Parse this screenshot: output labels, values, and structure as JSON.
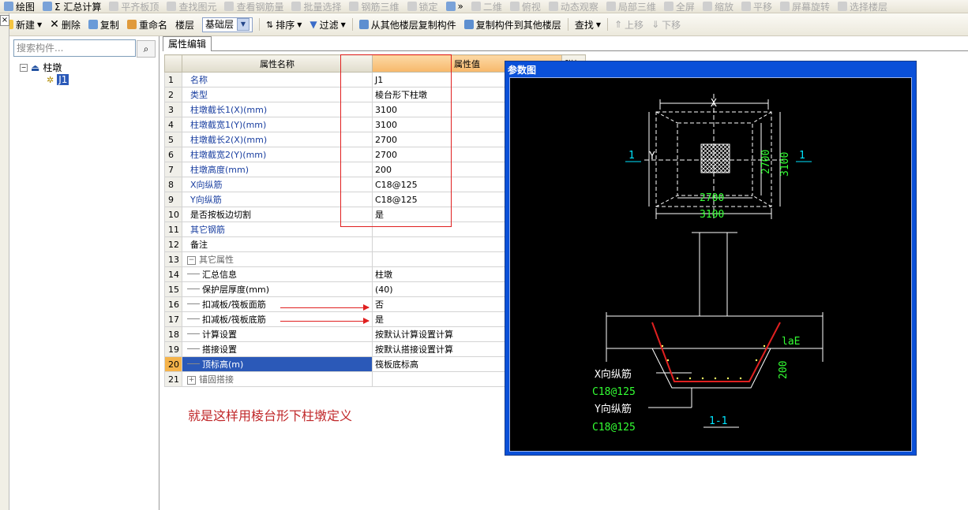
{
  "toolbar1": {
    "items": [
      {
        "label": "绘图",
        "disabled": false
      },
      {
        "label": "Σ 汇总计算",
        "disabled": false
      },
      {
        "label": "平齐板顶",
        "disabled": true
      },
      {
        "label": "查找图元",
        "disabled": true
      },
      {
        "label": "查看钢筋量",
        "disabled": true
      },
      {
        "label": "批量选择",
        "disabled": true
      },
      {
        "label": "钢筋三维",
        "disabled": true
      },
      {
        "label": "锁定",
        "disabled": true
      },
      {
        "label": "»",
        "disabled": false
      },
      {
        "label": "二维",
        "disabled": true
      },
      {
        "label": "俯视",
        "disabled": true
      },
      {
        "label": "动态观察",
        "disabled": true
      },
      {
        "label": "局部三维",
        "disabled": true
      },
      {
        "label": "全屏",
        "disabled": true
      },
      {
        "label": "缩放",
        "disabled": true
      },
      {
        "label": "平移",
        "disabled": true
      },
      {
        "label": "屏幕旋转",
        "disabled": true
      },
      {
        "label": "选择楼层",
        "disabled": true
      }
    ]
  },
  "toolbar2": {
    "new_label": "新建",
    "delete_label": "删除",
    "copy_label": "复制",
    "rename_label": "重命名",
    "floor_label": "楼层",
    "floor_value": "基础层",
    "sort_label": "排序",
    "filter_label": "过滤",
    "copy_from_label": "从其他楼层复制构件",
    "copy_to_label": "复制构件到其他楼层",
    "find_label": "查找",
    "up_label": "上移",
    "down_label": "下移"
  },
  "left_tab": {
    "close": "×"
  },
  "sidebar": {
    "search_placeholder": "搜索构件...",
    "root_label": "柱墩",
    "child_label": "J1"
  },
  "tab": {
    "label": "属性编辑"
  },
  "table": {
    "col_name": "属性名称",
    "col_value": "属性值",
    "col_extra": "附加",
    "rows": [
      {
        "n": "1",
        "name": "名称",
        "value": "J1"
      },
      {
        "n": "2",
        "name": "类型",
        "value": "棱台形下柱墩"
      },
      {
        "n": "3",
        "name": "柱墩截长1(X)(mm)",
        "value": "3100"
      },
      {
        "n": "4",
        "name": "柱墩截宽1(Y)(mm)",
        "value": "3100"
      },
      {
        "n": "5",
        "name": "柱墩截长2(X)(mm)",
        "value": "2700"
      },
      {
        "n": "6",
        "name": "柱墩截宽2(Y)(mm)",
        "value": "2700"
      },
      {
        "n": "7",
        "name": "柱墩高度(mm)",
        "value": "200"
      },
      {
        "n": "8",
        "name": "X向纵筋",
        "value": "C18@125"
      },
      {
        "n": "9",
        "name": "Y向纵筋",
        "value": "C18@125"
      },
      {
        "n": "10",
        "name": "是否按板边切割",
        "value": "是"
      },
      {
        "n": "11",
        "name": "其它钢筋",
        "value": ""
      },
      {
        "n": "12",
        "name": "备注",
        "value": ""
      },
      {
        "n": "13",
        "name": "其它属性",
        "value": ""
      },
      {
        "n": "14",
        "name": "汇总信息",
        "value": "柱墩"
      },
      {
        "n": "15",
        "name": "保护层厚度(mm)",
        "value": "(40)"
      },
      {
        "n": "16",
        "name": "扣减板/筏板面筋",
        "value": "否"
      },
      {
        "n": "17",
        "name": "扣减板/筏板底筋",
        "value": "是"
      },
      {
        "n": "18",
        "name": "计算设置",
        "value": "按默认计算设置计算"
      },
      {
        "n": "19",
        "name": "搭接设置",
        "value": "按默认搭接设置计算"
      },
      {
        "n": "20",
        "name": "顶标高(m)",
        "value": "筏板底标高"
      },
      {
        "n": "21",
        "name": "锚固搭接",
        "value": ""
      }
    ]
  },
  "annotation": "就是这样用棱台形下柱墩定义",
  "param_window": {
    "title": "参数图",
    "labels": {
      "x": "X",
      "y": "Y",
      "sec1": "1",
      "sec2": "1",
      "dim_2700_v": "2700",
      "dim_3100_v": "3100",
      "dim_2700_h": "2700",
      "dim_3100_h": "3100",
      "lae": "laE",
      "h200": "200",
      "xbar": "X向纵筋",
      "xbar_val": "C18@125",
      "ybar": "Y向纵筋",
      "ybar_val": "C18@125",
      "section": "1-1"
    }
  },
  "colors": {
    "accent_blue": "#2b59b8",
    "red": "#e02020",
    "cad_green": "#33ff33",
    "cad_cyan": "#00e5ff"
  }
}
